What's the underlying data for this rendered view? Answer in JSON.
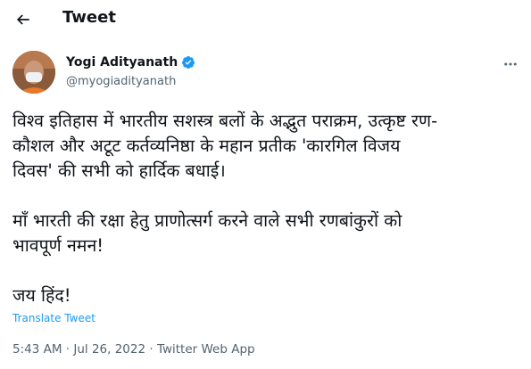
{
  "header": {
    "title": "Tweet"
  },
  "author": {
    "name": "Yogi Adityanath",
    "handle": "@myogiadityanath"
  },
  "tweet": {
    "text": "विश्व इतिहास में भारतीय सशस्त्र बलों के अद्भुत पराक्रम, उत्कृष्ट रण-\nकौशल और अटूट कर्तव्यनिष्ठा के महान प्रतीक 'कारगिल विजय\nदिवस' की सभी को हार्दिक बधाई।\n\nमाँ भारती की रक्षा हेतु प्राणोत्सर्ग करने वाले सभी रणबांकुरों को\nभावपूर्ण नमन!\n\nजय हिंद!",
    "translate_label": "Translate Tweet",
    "time": "5:43 AM",
    "date": "Jul 26, 2022",
    "source": "Twitter Web App",
    "separator": " · "
  },
  "icons": {
    "back": "arrow-left-icon",
    "verified": "verified-badge-icon",
    "more": "more-horizontal-icon"
  },
  "colors": {
    "accent": "#1d9bf0",
    "secondary_text": "#536471",
    "primary_text": "#0f1419"
  }
}
